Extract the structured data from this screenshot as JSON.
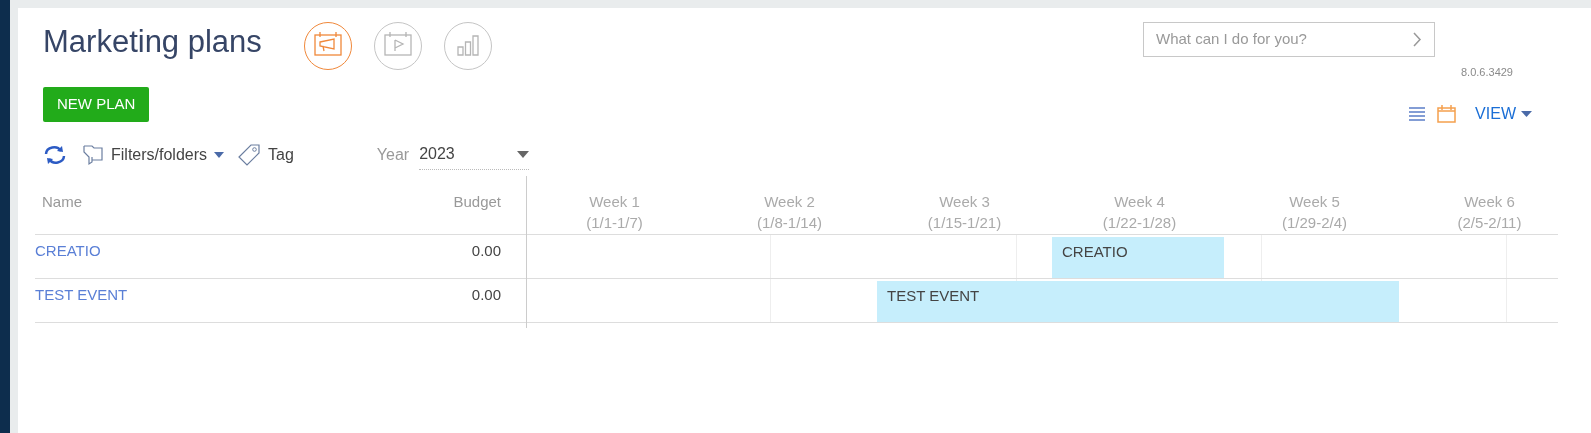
{
  "page": {
    "title": "Marketing plans",
    "version": "8.0.6.3429"
  },
  "sections": [
    {
      "kind": "campaign",
      "selected": true
    },
    {
      "kind": "event",
      "selected": false
    },
    {
      "kind": "analytics",
      "selected": false
    }
  ],
  "search": {
    "placeholder": "What can I do for you?"
  },
  "new_plan_button": "NEW PLAN",
  "view_modes": [
    {
      "kind": "list",
      "selected": false
    },
    {
      "kind": "calendar",
      "selected": true
    }
  ],
  "view_button": "VIEW",
  "toolbar": {
    "filters": "Filters/folders",
    "tag": "Tag",
    "year_label": "Year",
    "year_value": "2023"
  },
  "table": {
    "columns": [
      "Name",
      "Budget"
    ],
    "weeks": [
      {
        "label": "Week 1",
        "range": "(1/1-1/7)"
      },
      {
        "label": "Week 2",
        "range": "(1/8-1/14)"
      },
      {
        "label": "Week 3",
        "range": "(1/15-1/21)"
      },
      {
        "label": "Week 4",
        "range": "(1/22-1/28)"
      },
      {
        "label": "Week 5",
        "range": "(1/29-2/4)"
      },
      {
        "label": "Week 6",
        "range": "(2/5-2/11)"
      }
    ],
    "rows": [
      {
        "name": "CREATIO",
        "budget": "0.00",
        "bar": {
          "label": "CREATIO",
          "weeks_covered": [
            false,
            false,
            false,
            true,
            false,
            false
          ]
        }
      },
      {
        "name": "TEST EVENT",
        "budget": "0.00",
        "bar": {
          "label": "TEST EVENT",
          "weeks_covered": [
            false,
            false,
            true,
            true,
            true,
            false
          ]
        }
      }
    ]
  }
}
